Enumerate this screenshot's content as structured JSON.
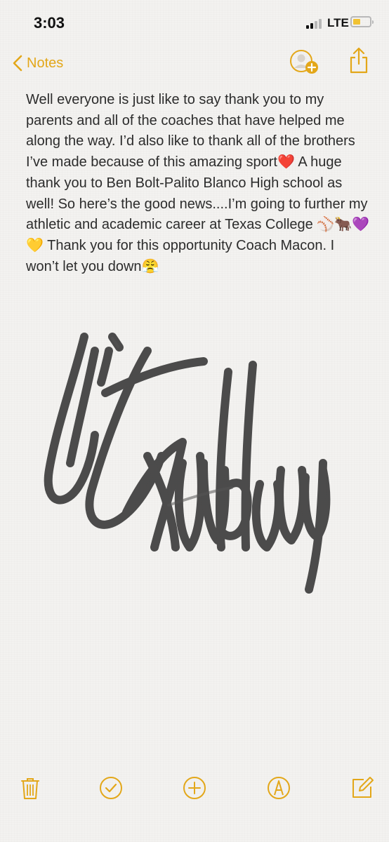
{
  "status_bar": {
    "time": "3:03",
    "network": "LTE",
    "battery_level": 0.4,
    "signal_bars_active": 2,
    "signal_bars_total": 4
  },
  "nav": {
    "back_label": "Notes",
    "accent_color": "#e3a719",
    "icons": [
      "chevron-left-icon",
      "add-person-icon",
      "share-icon"
    ]
  },
  "note": {
    "body": "Well everyone is just like to say thank you to my parents and all of the coaches that have helped me along the way. I’d also like to thank all of the brothers I’ve made because of this amazing sport❤️ A huge thank you to Ben Bolt-Palito Blanco High school as well! So here’s the good news....I’m going to further my athletic and academic career at Texas College ⚾️🐂💜💛 Thank you for this opportunity Coach Macon. I won’t let you down😤",
    "signature": "TJ Dulbaugh handwritten signature"
  },
  "toolbar": {
    "icons": [
      "trash-icon",
      "checklist-icon",
      "add-icon",
      "markup-icon",
      "compose-icon"
    ]
  }
}
